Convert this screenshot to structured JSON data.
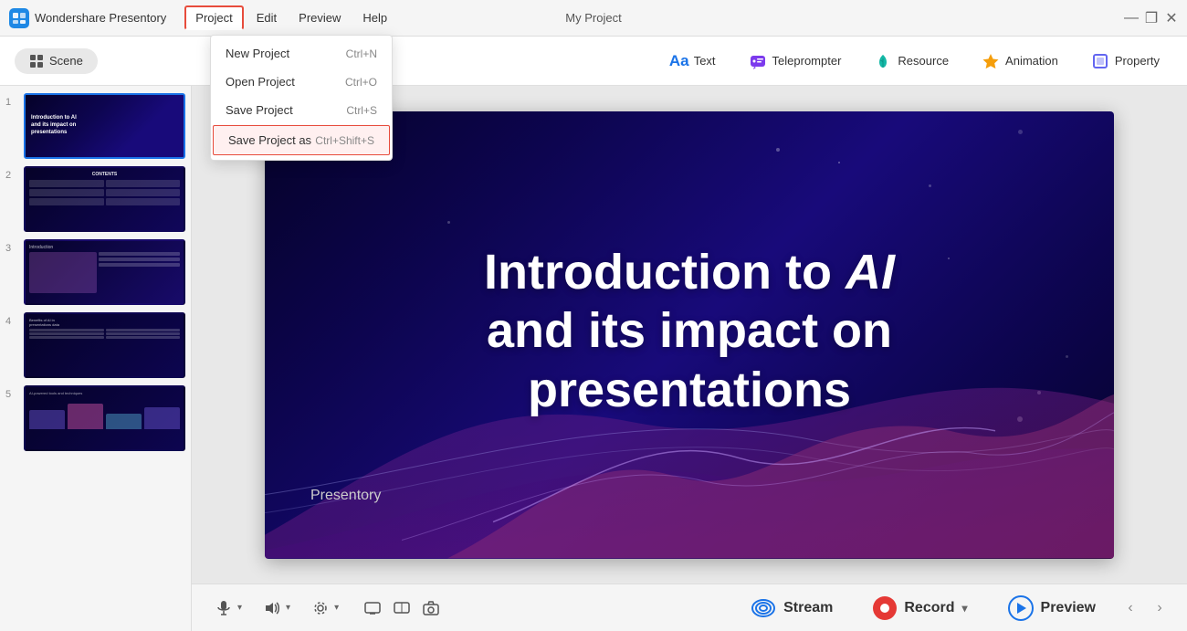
{
  "app": {
    "name": "Wondershare Presentory",
    "title": "My Project"
  },
  "titlebar": {
    "minimize": "—",
    "maximize": "❐",
    "close": "✕"
  },
  "menubar": {
    "items": [
      {
        "id": "project",
        "label": "Project",
        "active": true
      },
      {
        "id": "edit",
        "label": "Edit",
        "active": false
      },
      {
        "id": "preview",
        "label": "Preview",
        "active": false
      },
      {
        "id": "help",
        "label": "Help",
        "active": false
      }
    ]
  },
  "dropdown": {
    "items": [
      {
        "id": "new-project",
        "label": "New Project",
        "shortcut": "Ctrl+N",
        "highlighted": false
      },
      {
        "id": "open-project",
        "label": "Open Project",
        "shortcut": "Ctrl+O",
        "highlighted": false
      },
      {
        "id": "save-project",
        "label": "Save Project",
        "shortcut": "Ctrl+S",
        "highlighted": false
      },
      {
        "id": "save-project-as",
        "label": "Save Project as",
        "shortcut": "Ctrl+Shift+S",
        "highlighted": true
      }
    ]
  },
  "toolbar": {
    "scene_label": "Scene",
    "tools": [
      {
        "id": "text",
        "label": "Text",
        "icon": "Aa"
      },
      {
        "id": "teleprompter",
        "label": "Teleprompter",
        "icon": "💬"
      },
      {
        "id": "resource",
        "label": "Resource",
        "icon": "🌿"
      },
      {
        "id": "animation",
        "label": "Animation",
        "icon": "⭐"
      },
      {
        "id": "property",
        "label": "Property",
        "icon": "🔲"
      }
    ]
  },
  "slides": [
    {
      "number": "1",
      "type": "title",
      "active": true,
      "title_line1": "Introduction to AI",
      "title_line2": "and its impact on",
      "title_line3": "presentations"
    },
    {
      "number": "2",
      "type": "contents",
      "active": false
    },
    {
      "number": "3",
      "type": "intro",
      "active": false
    },
    {
      "number": "4",
      "type": "data",
      "active": false
    },
    {
      "number": "5",
      "type": "detail",
      "active": false
    }
  ],
  "main_slide": {
    "title": "Introduction to AI\nand its impact on\npresentations",
    "subtitle": "Presentory"
  },
  "bottom_toolbar": {
    "stream_label": "Stream",
    "record_label": "Record",
    "preview_label": "Preview"
  }
}
